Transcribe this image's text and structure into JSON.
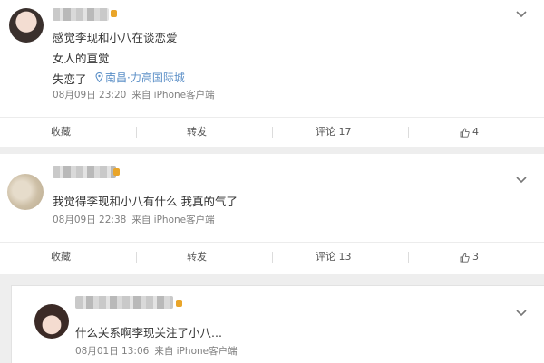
{
  "posts": [
    {
      "lines": [
        "感觉李现和小八在谈恋爱",
        "女人的直觉",
        "失恋了"
      ],
      "location": "南昌·力高国际城",
      "meta": {
        "date": "08月09日 23:20",
        "source": "来自 iPhone客户端"
      },
      "actions": {
        "favorite": "收藏",
        "repost": "转发",
        "comment": "评论 17",
        "like": "4"
      }
    },
    {
      "lines": [
        "我觉得李现和小八有什么 我真的气了"
      ],
      "meta": {
        "date": "08月09日 22:38",
        "source": "来自 iPhone客户端"
      },
      "actions": {
        "favorite": "收藏",
        "repost": "转发",
        "comment": "评论 13",
        "like": "3"
      }
    }
  ],
  "reply": {
    "text": "什么关系啊李现关注了小八...",
    "meta": {
      "date": "08月01日 13:06",
      "source": "来自 iPhone客户端"
    }
  },
  "icons": {
    "more": "chevron-down-icon",
    "location": "location-pin-icon",
    "like": "thumbs-up-icon",
    "vip": "vip-badge-icon"
  }
}
